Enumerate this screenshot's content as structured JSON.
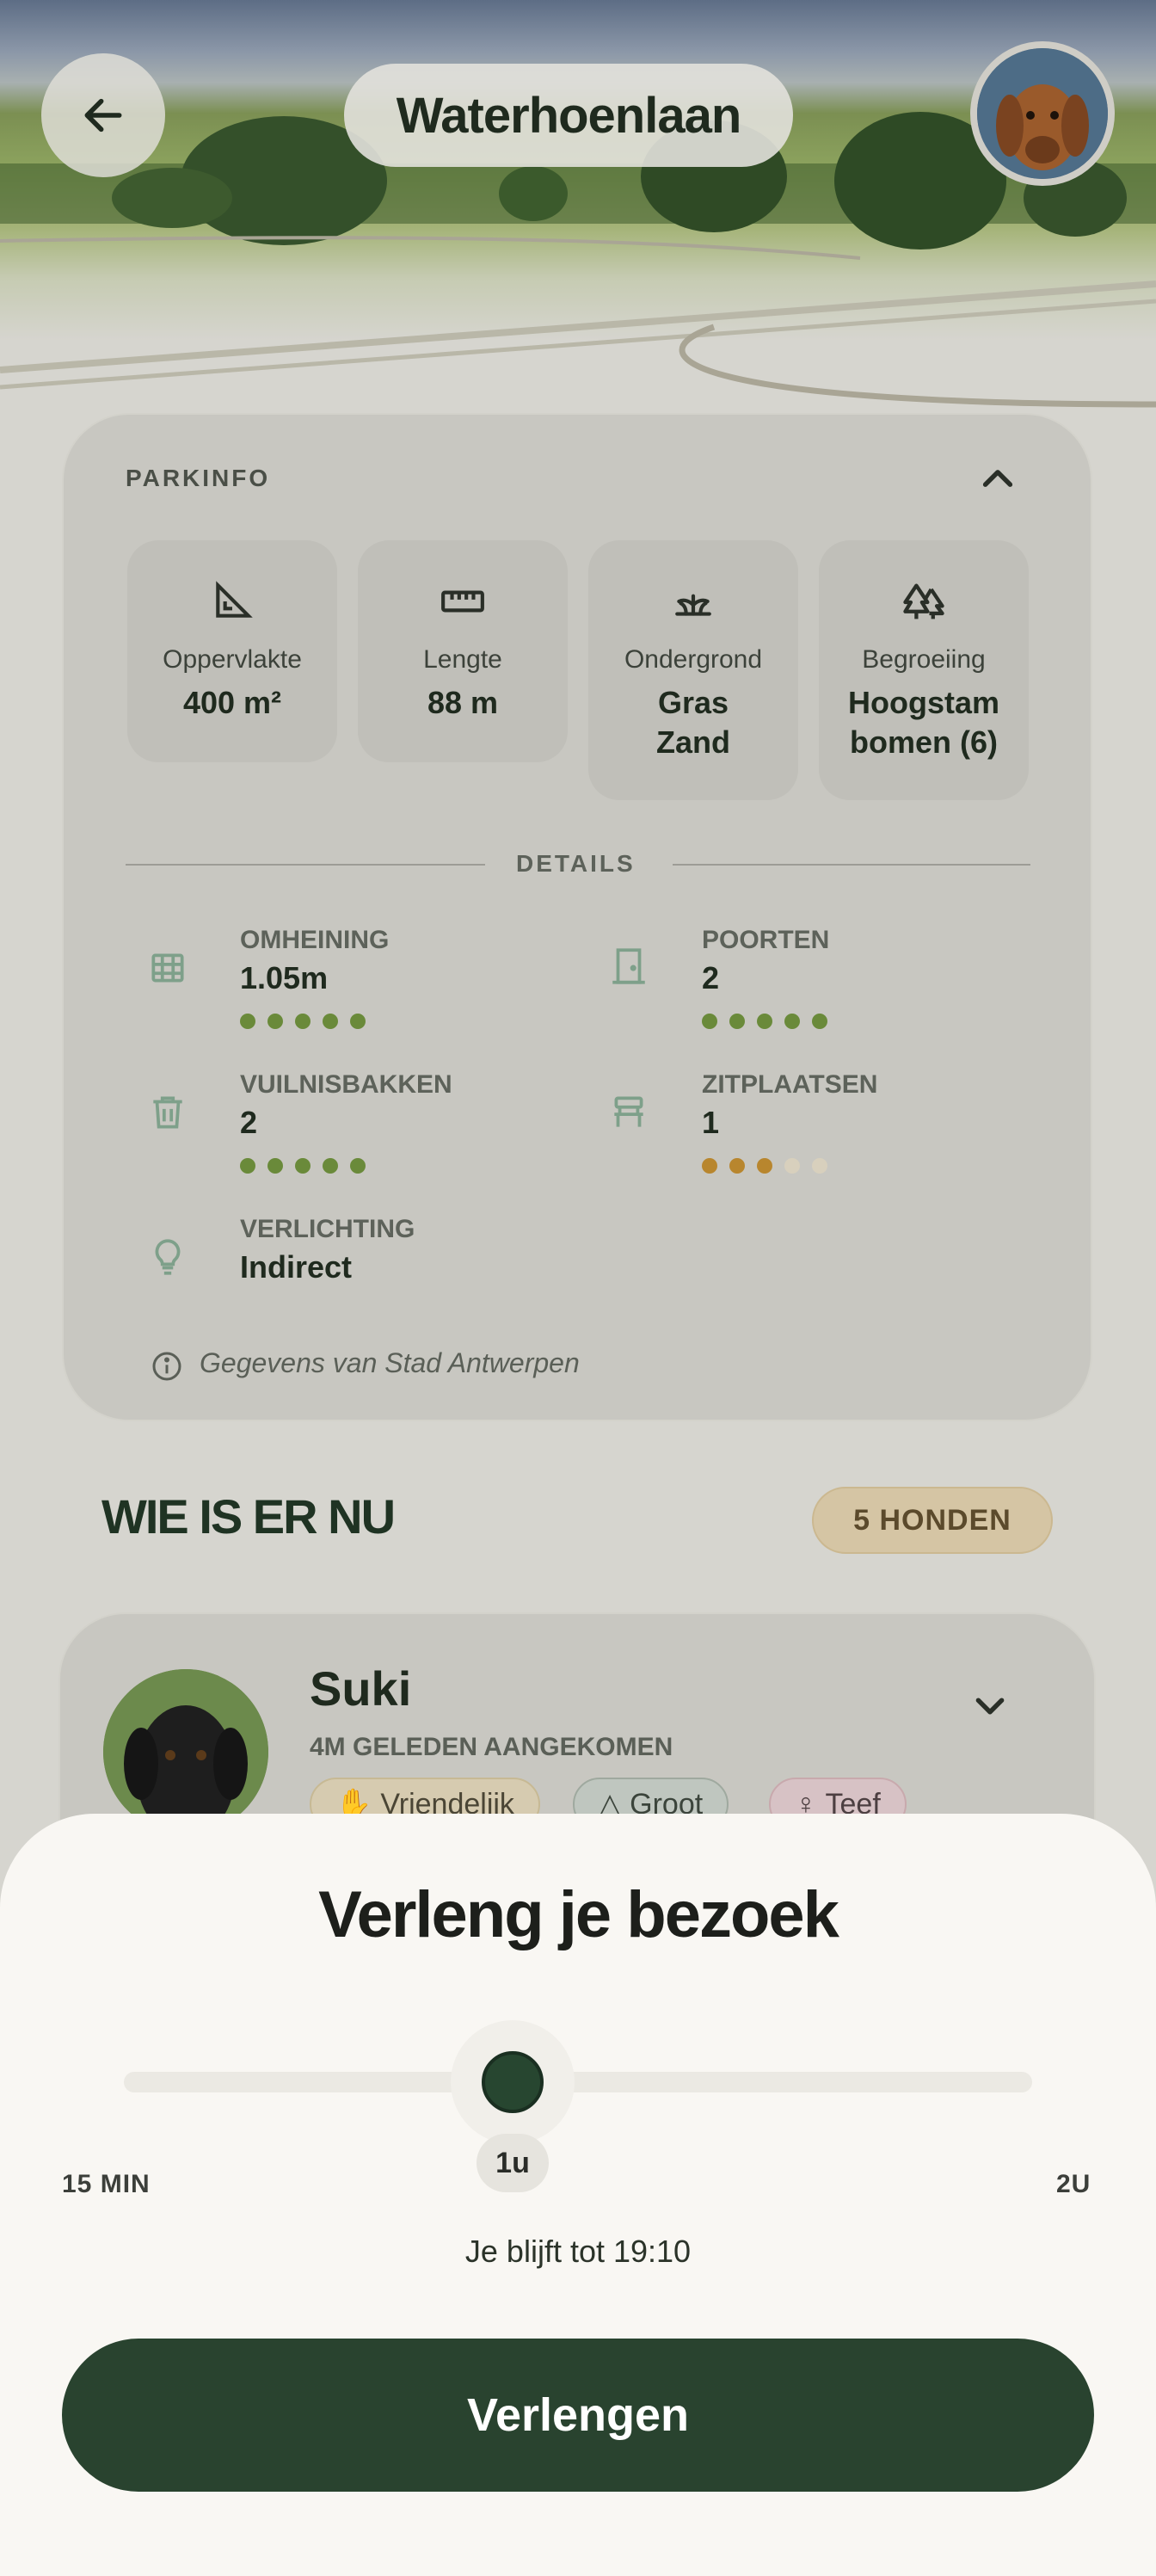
{
  "header": {
    "title": "Waterhoenlaan"
  },
  "park_info": {
    "section_label": "PARKINFO",
    "stats": [
      {
        "icon": "set-square-icon",
        "label": "Oppervlakte",
        "value": "400 m²"
      },
      {
        "icon": "ruler-icon",
        "label": "Lengte",
        "value": "88 m"
      },
      {
        "icon": "grass-icon",
        "label": "Ondergrond",
        "value": "Gras Zand"
      },
      {
        "icon": "trees-icon",
        "label": "Begroeiing",
        "value": "Hoogstam bomen (6)"
      }
    ],
    "details_label": "DETAILS",
    "details": {
      "fence": {
        "label": "OMHEINING",
        "value": "1.05m",
        "rating": 5
      },
      "gates": {
        "label": "POORTEN",
        "value": "2",
        "rating": 5
      },
      "bins": {
        "label": "VUILNISBAKKEN",
        "value": "2",
        "rating": 5
      },
      "seats": {
        "label": "ZITPLAATSEN",
        "value": "1",
        "rating": 3
      },
      "lighting": {
        "label": "VERLICHTING",
        "value": "Indirect"
      }
    },
    "source": "Gegevens van Stad Antwerpen",
    "colors": {
      "rating_good": "#6a8a3a",
      "rating_mid": "#b8862e",
      "rating_empty": "#e6dcc8"
    }
  },
  "who": {
    "title": "WIE IS ER NU",
    "count_badge": "5 HONDEN",
    "dogs": [
      {
        "name": "Suki",
        "arrived": "4M GELEDEN AANGEKOMEN",
        "tags": [
          "Vriendelijk",
          "Groot",
          "Teef"
        ]
      }
    ]
  },
  "sheet": {
    "title": "Verleng je bezoek",
    "min_label": "15 MIN",
    "max_label": "2U",
    "selected_label": "1u",
    "slider_fraction": 0.4,
    "until_text": "Je blijft tot 19:10",
    "cta_label": "Verlengen",
    "accent": "#29432f"
  }
}
